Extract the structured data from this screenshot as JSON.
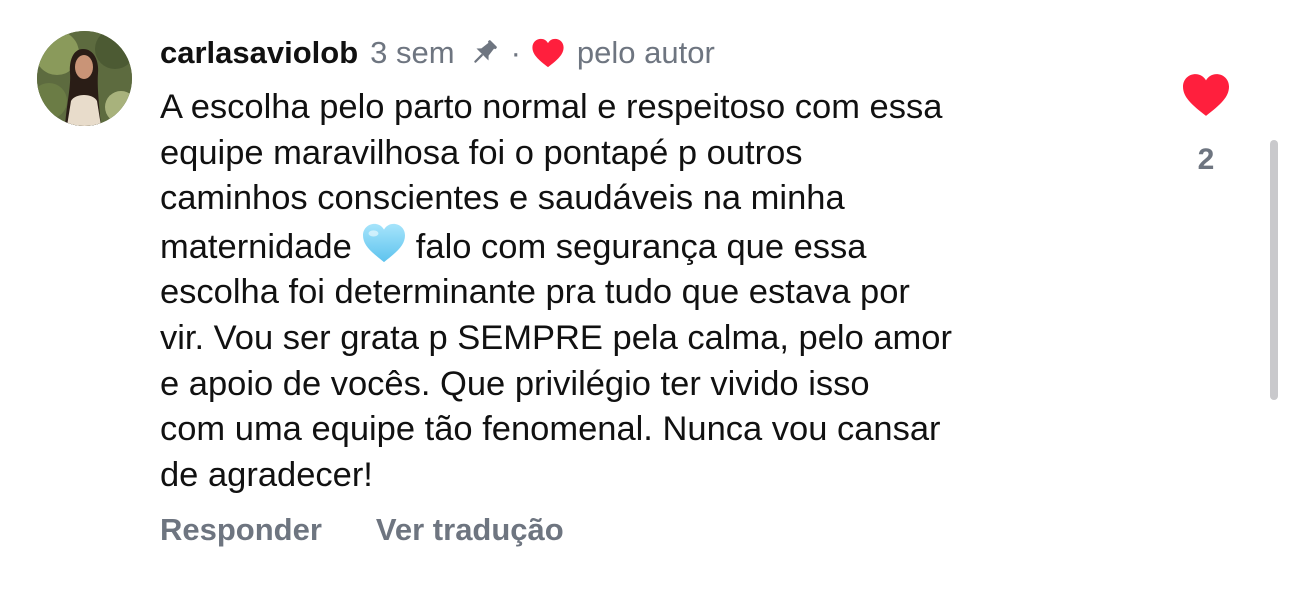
{
  "comment": {
    "username": "carlasaviolob",
    "time": "3 sem",
    "separator": "·",
    "author_like_label": "pelo autor",
    "body_before_emoji": "A escolha pelo parto normal e respeitoso com essa\nequipe maravilhosa foi o pontapé p outros\ncaminhos conscientes e saudáveis na minha\nmaternidade",
    "body_after_emoji": "falo com segurança que essa\nescolha foi determinante pra tudo que estava por\nvir. Vou ser grata p SEMPRE pela calma, pelo amor\ne apoio de vocês. Que privilégio ter vivido isso\ncom uma equipe tão fenomenal. Nunca vou cansar\nde agradecer!",
    "emoji": "light-blue-heart-icon",
    "like_count": "2",
    "actions": {
      "reply": "Responder",
      "translate": "Ver tradução"
    }
  },
  "icons": {
    "pin": "pin-icon",
    "author_heart": "heart-icon",
    "like": "heart-filled-icon"
  },
  "colors": {
    "text_primary": "#111111",
    "text_secondary": "#6e7580",
    "heart_red": "#ff1f3d",
    "emoji_blue": "#7fd3f7",
    "scrollbar": "#c9c9cc"
  }
}
